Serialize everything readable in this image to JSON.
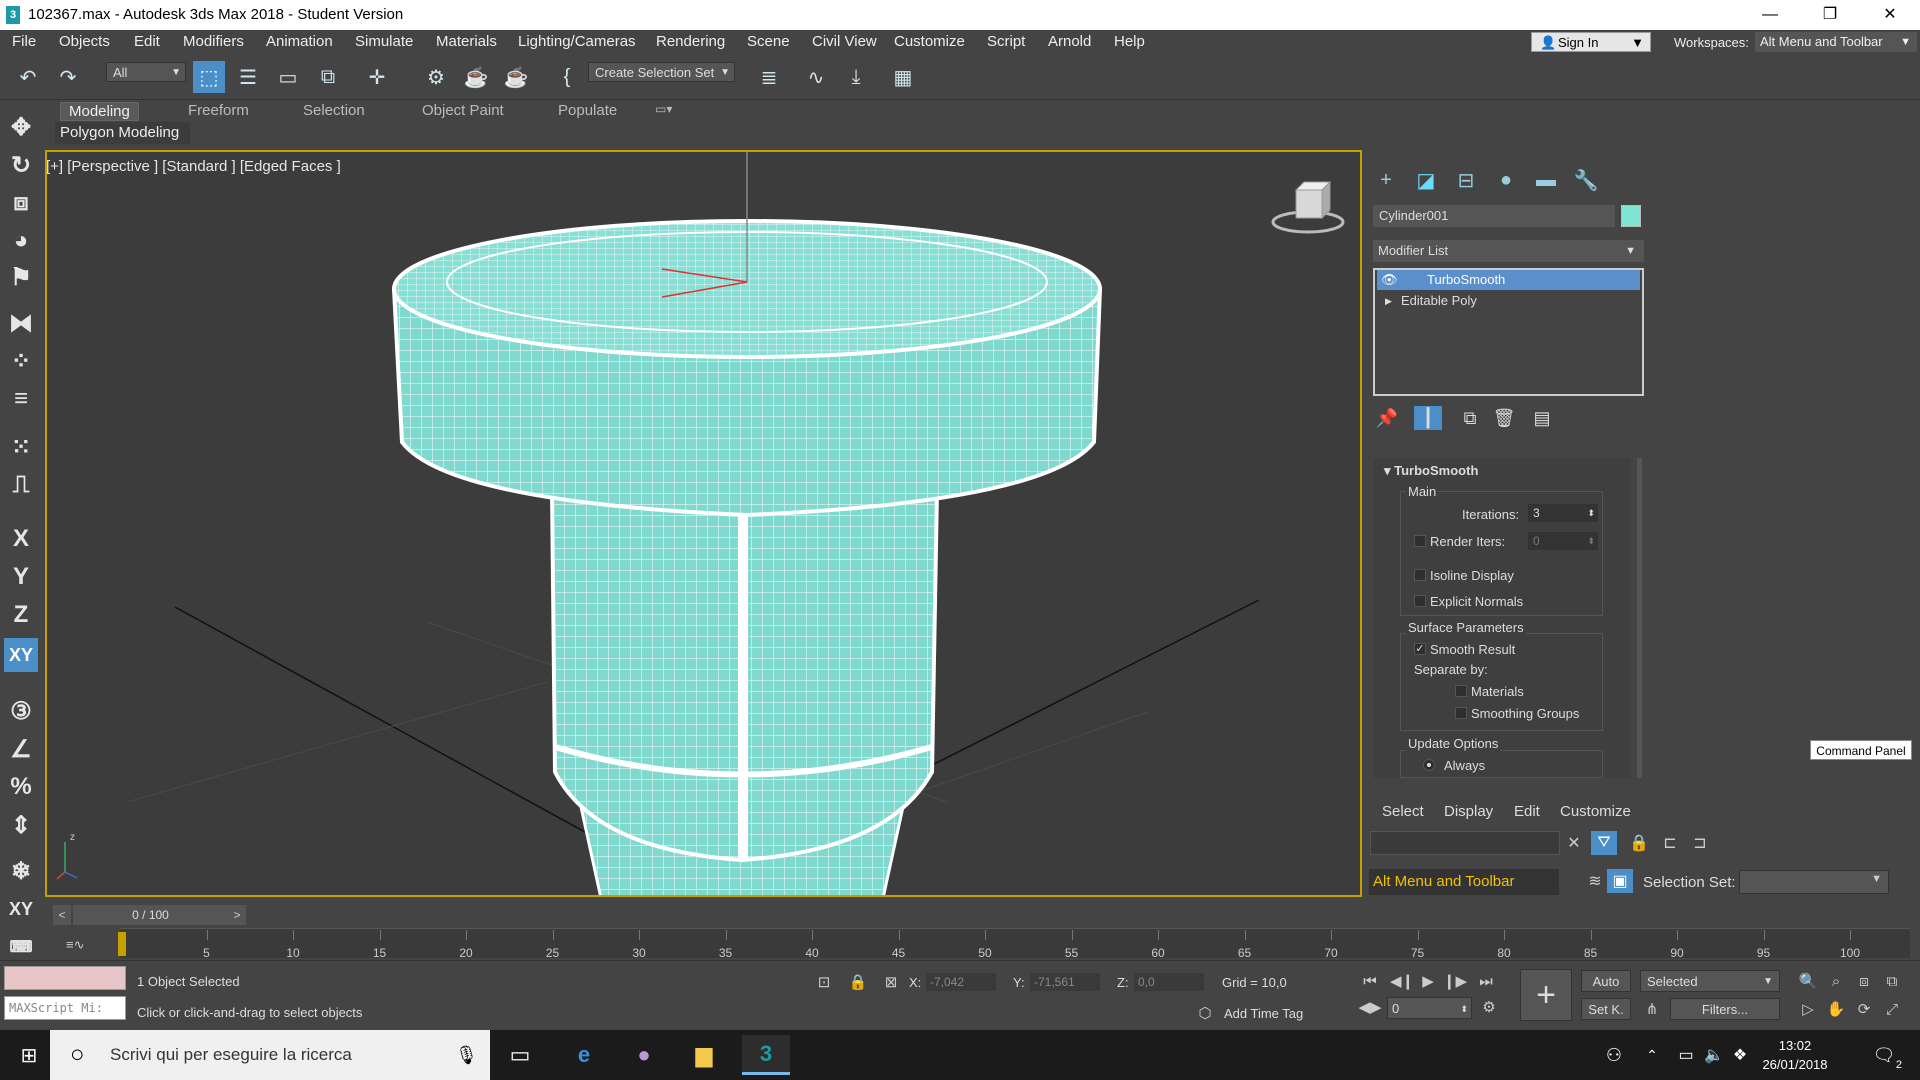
{
  "window": {
    "title": "102367.max - Autodesk 3ds Max 2018 - Student Version",
    "app_icon": "3",
    "minimize": "—",
    "maximize": "❐",
    "close": "✕"
  },
  "menu": [
    "File",
    "Objects",
    "Edit",
    "Modifiers",
    "Animation",
    "Simulate",
    "Materials",
    "Lighting/Cameras",
    "Rendering",
    "Scene",
    "Civil View",
    "Customize",
    "Script",
    "Arnold",
    "Help"
  ],
  "account": {
    "sign_in": "Sign In",
    "workspaces_label": "Workspaces:",
    "workspace": "Alt Menu and Toolbar"
  },
  "toolbar": {
    "filter": "All",
    "selection_set": "Create Selection Set"
  },
  "ribbon": {
    "tabs": [
      "Modeling",
      "Freeform",
      "Selection",
      "Object Paint",
      "Populate"
    ],
    "active_tab": "Modeling",
    "panel": "Polygon Modeling"
  },
  "left_toolbar": [
    "X",
    "Y",
    "Z",
    "XY"
  ],
  "viewport": {
    "label": "[+] [Perspective ] [Standard ] [Edged Faces ]",
    "axis_z": "z"
  },
  "command_panel": {
    "object_name": "Cylinder001",
    "object_color": "#7fe6d6",
    "modifier_list": "Modifier List",
    "stack": [
      "TurboSmooth",
      "Editable Poly"
    ],
    "selected_modifier": "TurboSmooth",
    "rollout": {
      "title": "TurboSmooth",
      "main_group": "Main",
      "iterations_label": "Iterations:",
      "iterations": "3",
      "render_iters_label": "Render Iters:",
      "render_iters": "0",
      "isoline_display": "Isoline Display",
      "explicit_normals": "Explicit Normals",
      "surface_group": "Surface Parameters",
      "smooth_result": "Smooth Result",
      "separate_by": "Separate by:",
      "materials": "Materials",
      "smoothing_groups": "Smoothing Groups",
      "update_group": "Update Options",
      "always": "Always"
    },
    "tooltip": "Command Panel"
  },
  "scene_explorer": {
    "menu": [
      "Select",
      "Display",
      "Edit",
      "Customize"
    ],
    "workspace": "Alt Menu and Toolbar",
    "selection_set_label": "Selection Set:"
  },
  "timeline": {
    "frame": "0 / 100",
    "ticks": [
      5,
      10,
      15,
      20,
      25,
      30,
      35,
      40,
      45,
      50,
      55,
      60,
      65,
      70,
      75,
      80,
      85,
      90,
      95,
      100
    ]
  },
  "status": {
    "maxscript": "MAXScript Mi:",
    "selection": "1 Object Selected",
    "prompt": "Click or click-and-drag to select objects",
    "x_label": "X:",
    "x": "-7,042",
    "y_label": "Y:",
    "y": "-71,561",
    "z_label": "Z:",
    "z": "0,0",
    "grid": "Grid = 10,0",
    "add_time_tag": "Add Time Tag",
    "auto": "Auto",
    "set_key": "Set K.",
    "selected": "Selected",
    "filters": "Filters...",
    "current_frame": "0"
  },
  "taskbar": {
    "search": "Scrivi qui per eseguire la ricerca",
    "time": "13:02",
    "date": "26/01/2018",
    "notifications": "2"
  }
}
